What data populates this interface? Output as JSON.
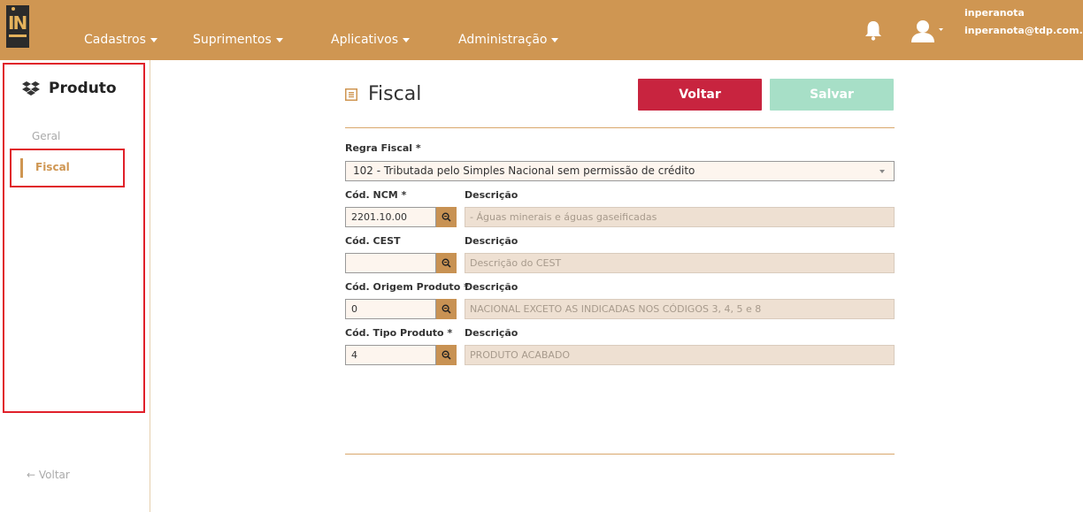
{
  "colors": {
    "topbar": "#cf9652",
    "accent": "#cf9652",
    "back_button": "#c8243f",
    "save_button": "#a7dfc7",
    "highlight_outline": "#e0202a"
  },
  "header": {
    "logo_text": "IN",
    "nav": [
      "Cadastros",
      "Suprimentos",
      "Aplicativos",
      "Administração"
    ],
    "user_name": "inperanota",
    "user_email": "inperanota@tdp.com.br",
    "icons": [
      "bell-icon",
      "user-icon"
    ]
  },
  "sidebar": {
    "title": "Produto",
    "items": [
      {
        "label": "Geral",
        "active": false
      },
      {
        "label": "Fiscal",
        "active": true
      }
    ],
    "back_label": "← Voltar"
  },
  "main": {
    "title": "Fiscal",
    "back_button": "Voltar",
    "save_button": "Salvar",
    "regra_fiscal": {
      "label": "Regra Fiscal *",
      "value": "102 - Tributada pelo Simples Nacional sem permissão de crédito"
    },
    "ncm": {
      "label": "Cód. NCM *",
      "value": "2201.10.00",
      "desc_label": "Descrição",
      "desc_value": "- Águas minerais e águas gaseificadas"
    },
    "cest": {
      "label": "Cód. CEST",
      "value": "",
      "desc_label": "Descrição",
      "desc_placeholder": "Descrição do CEST"
    },
    "origem": {
      "label": "Cód. Origem Produto *",
      "value": "0",
      "desc_label": "Descrição",
      "desc_value": "NACIONAL EXCETO AS INDICADAS NOS CÓDIGOS 3, 4, 5 e 8"
    },
    "tipo": {
      "label": "Cód. Tipo Produto *",
      "value": "4",
      "desc_label": "Descrição",
      "desc_value": "PRODUTO ACABADO"
    }
  }
}
